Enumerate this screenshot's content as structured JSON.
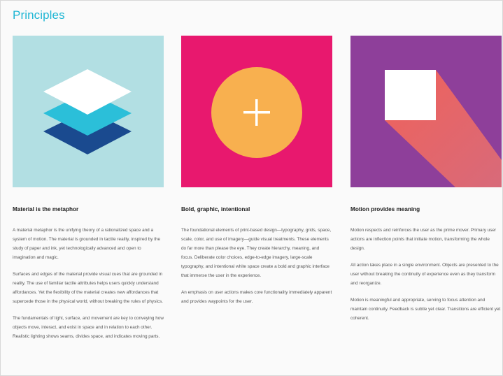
{
  "page": {
    "title": "Principles"
  },
  "colors": {
    "title": "#1fb6d4",
    "card1_bg": "#b2dfe3",
    "card2_bg": "#e8186e",
    "card3_bg": "#8e3f9a",
    "layer_top": "#ffffff",
    "layer_mid": "#2bbfd9",
    "layer_bottom": "#1a4a8f",
    "circle": "#f8b04f",
    "shadow": "#e96a63"
  },
  "cards": [
    {
      "title": "Material is the metaphor",
      "icon": "stacked-layers-icon",
      "paragraphs": [
        "A material metaphor is the unifying theory of a rationalized space and a system of motion. The material is grounded in tactile reality, inspired by the study of paper and ink, yet technologically advanced and open to imagination and magic.",
        "Surfaces and edges of the material provide visual cues that are grounded in reality. The use of familiar tactile attributes helps users quickly understand affordances. Yet the flexibility of the material creates new affordances that supercede those in the physical world, without breaking the rules of physics.",
        "The fundamentals of light, surface, and movement are key to conveying how objects move, interact, and exist in space and in relation to each other. Realistic lighting shows seams, divides space, and indicates moving parts."
      ]
    },
    {
      "title": "Bold, graphic, intentional",
      "icon": "plus-circle-icon",
      "paragraphs": [
        "The foundational elements of print-based design—typography, grids, space, scale, color, and use of imagery—guide visual treatments. These elements do far more than please the eye. They create hierarchy, meaning, and focus. Deliberate color choices, edge-to-edge imagery, large-scale typography, and intentional white space create a bold and graphic interface that immerse the user in the experience.",
        "An emphasis on user actions makes core functionality immediately apparent and provides waypoints for the user."
      ]
    },
    {
      "title": "Motion provides meaning",
      "icon": "square-shadow-icon",
      "paragraphs": [
        "Motion respects and reinforces the user as the prime mover. Primary user actions are inflection points that initiate motion, transforming the whole design.",
        "All action takes place in a single environment. Objects are presented to the user without breaking the continuity of experience even as they transform and reorganize.",
        "Motion is meaningful and appropriate, serving to focus attention and maintain continuity. Feedback is subtle yet clear. Transitions are efficient yet coherent."
      ]
    }
  ]
}
